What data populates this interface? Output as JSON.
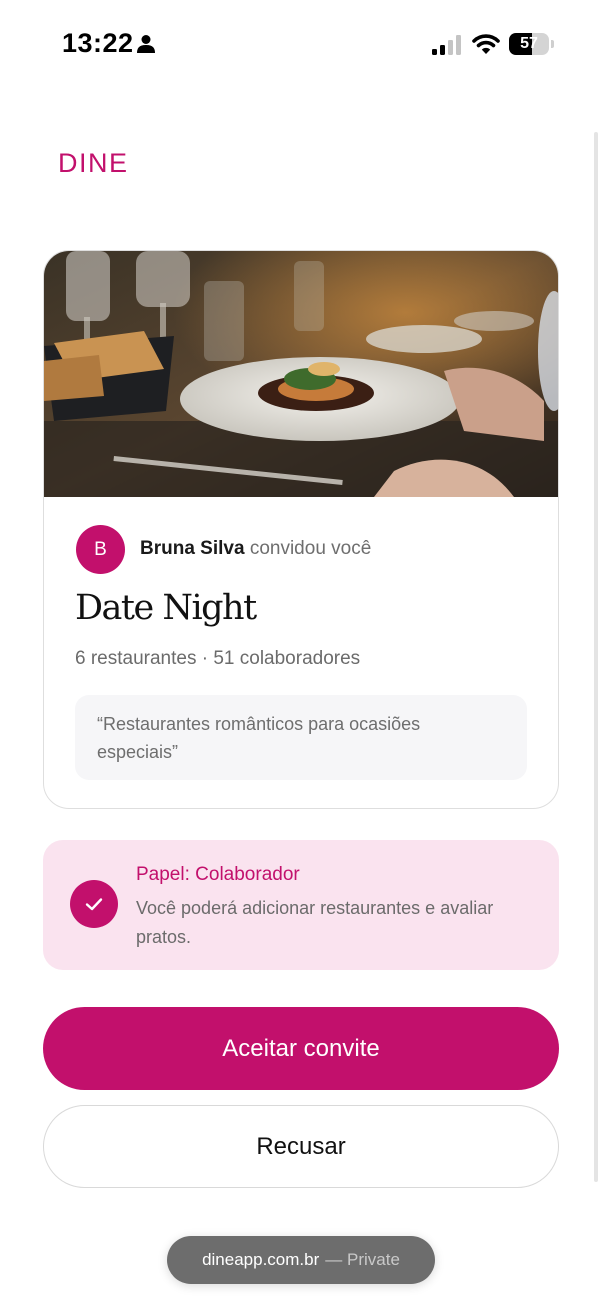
{
  "status_bar": {
    "time": "13:22",
    "battery_level": "57",
    "battery_fraction": 0.57,
    "icons": [
      "person-icon",
      "signal-icon",
      "wifi-icon",
      "battery-icon"
    ]
  },
  "brand": {
    "name": "DINE",
    "color": "#c2106c"
  },
  "invite_card": {
    "image": "restaurant-dish-photo",
    "inviter": {
      "avatar_letter": "B",
      "name": "Bruna Silva",
      "action": "convidou você"
    },
    "list_title": "Date Night",
    "meta": "6 restaurantes · 51 colaboradores",
    "description": "“Restaurantes românticos para ocasiões especiais”"
  },
  "role": {
    "title": "Papel: Colaborador",
    "description": "Você poderá adicionar restaurantes e avaliar pratos.",
    "icon": "check-icon",
    "background": "#fae3ef"
  },
  "actions": {
    "accept_label": "Aceitar convite",
    "decline_label": "Recusar",
    "accent": "#c2106c"
  },
  "browser": {
    "domain": "dineapp.com.br",
    "mode": "— Private"
  }
}
